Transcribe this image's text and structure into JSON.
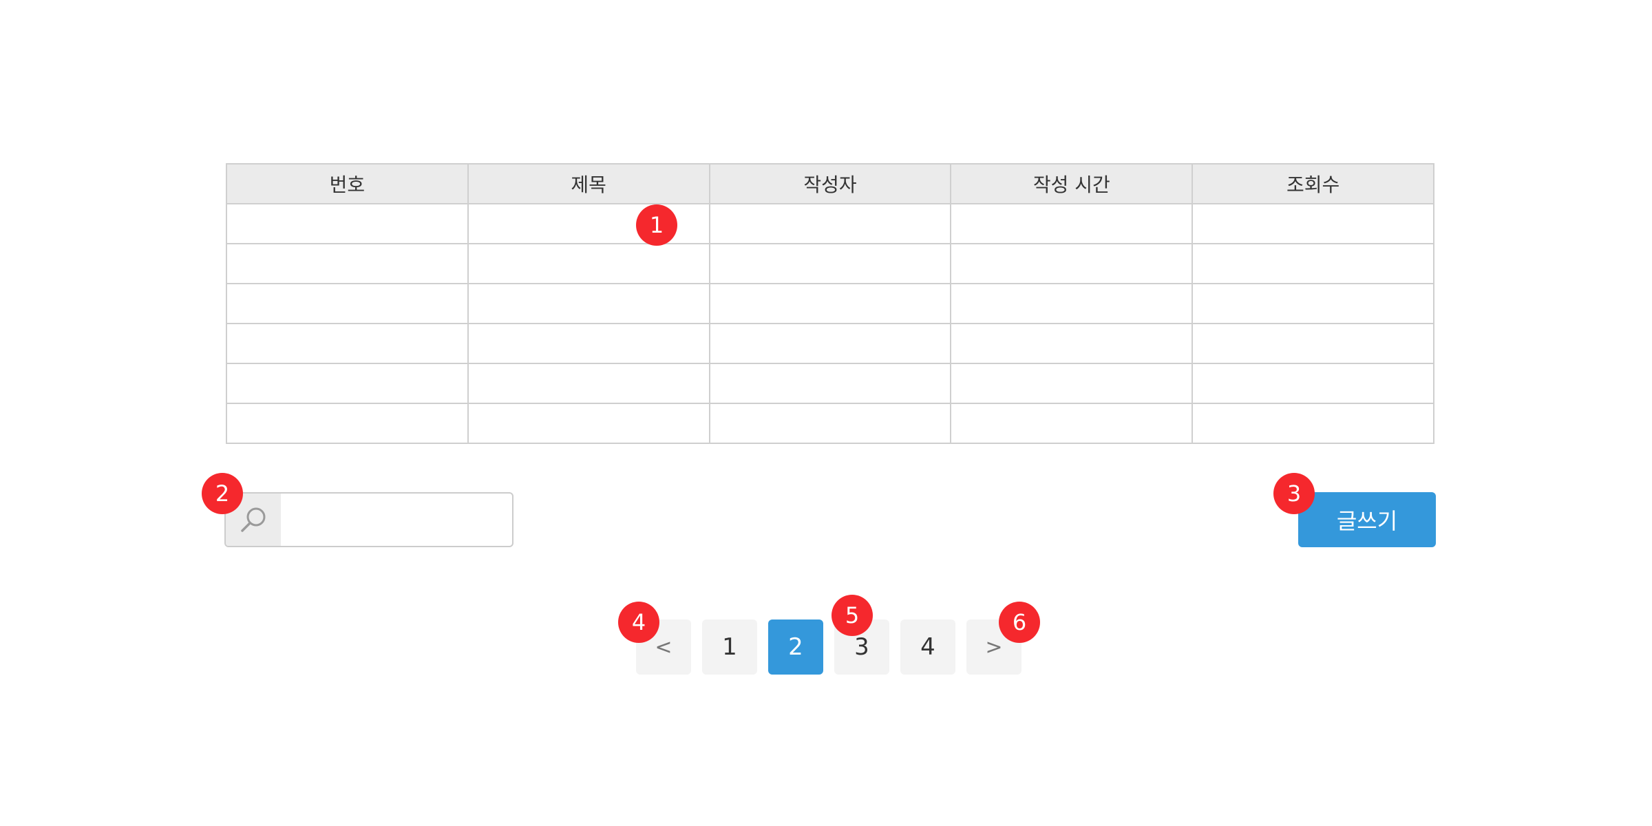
{
  "table": {
    "headers": [
      "번호",
      "제목",
      "작성자",
      "작성 시간",
      "조회수"
    ],
    "row_count": 6
  },
  "search": {
    "icon": "search-icon",
    "placeholder": "",
    "value": ""
  },
  "write_button": {
    "label": "글쓰기",
    "color": "#3498db"
  },
  "pagination": {
    "prev_label": "<",
    "next_label": ">",
    "pages": [
      "1",
      "2",
      "3",
      "4"
    ],
    "current_page": "2",
    "active_color": "#3498db"
  },
  "markers": [
    "1",
    "2",
    "3",
    "4",
    "5",
    "6"
  ],
  "colors": {
    "marker": "#f5282d",
    "header_bg": "#ebebeb",
    "border": "#cfcfcf"
  }
}
